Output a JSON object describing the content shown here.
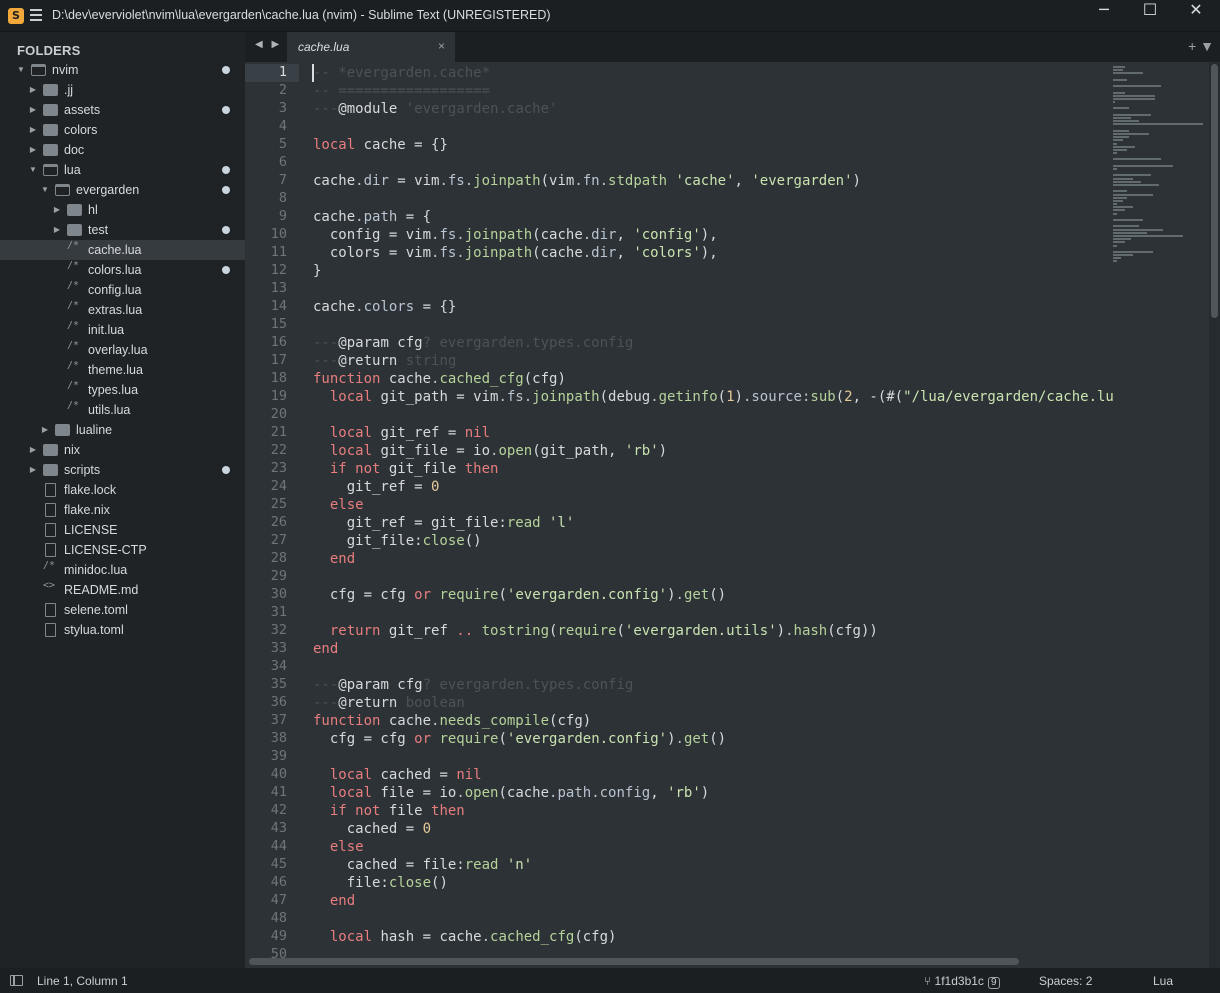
{
  "window": {
    "title": "D:\\dev\\everviolet\\nvim\\lua\\evergarden\\cache.lua (nvim) - Sublime Text (UNREGISTERED)",
    "app_icon": "S",
    "controls": {
      "minimize": "─",
      "maximize": "☐",
      "close": "✕"
    }
  },
  "sidebar": {
    "heading": "FOLDERS",
    "items": [
      {
        "label": "nvim"
      },
      {
        "label": ".jj"
      },
      {
        "label": "assets"
      },
      {
        "label": "colors"
      },
      {
        "label": "doc"
      },
      {
        "label": "lua"
      },
      {
        "label": "evergarden"
      },
      {
        "label": "hl"
      },
      {
        "label": "test"
      },
      {
        "label": "cache.lua"
      },
      {
        "label": "colors.lua"
      },
      {
        "label": "config.lua"
      },
      {
        "label": "extras.lua"
      },
      {
        "label": "init.lua"
      },
      {
        "label": "overlay.lua"
      },
      {
        "label": "theme.lua"
      },
      {
        "label": "types.lua"
      },
      {
        "label": "utils.lua"
      },
      {
        "label": "lualine"
      },
      {
        "label": "nix"
      },
      {
        "label": "scripts"
      },
      {
        "label": "flake.lock"
      },
      {
        "label": "flake.nix"
      },
      {
        "label": "LICENSE"
      },
      {
        "label": "LICENSE-CTP"
      },
      {
        "label": "minidoc.lua"
      },
      {
        "label": "README.md"
      },
      {
        "label": "selene.toml"
      },
      {
        "label": "stylua.toml"
      }
    ]
  },
  "tabs": {
    "nav": "◀ ▶",
    "active": {
      "label": "cache.lua",
      "close": "×"
    },
    "right_controls": "+ ▼"
  },
  "editor": {
    "language": "Lua",
    "line_numbers": [
      "1",
      "2",
      "3",
      "4",
      "5",
      "6",
      "7",
      "8",
      "9",
      "10",
      "11",
      "12",
      "13",
      "14",
      "15",
      "16",
      "17",
      "18",
      "19",
      "20",
      "21",
      "22",
      "23",
      "24",
      "25",
      "26",
      "27",
      "28",
      "29",
      "30",
      "31",
      "32",
      "33",
      "34",
      "35",
      "36",
      "37",
      "38",
      "39",
      "40",
      "41",
      "42",
      "43",
      "44",
      "45",
      "46",
      "47",
      "48",
      "49",
      "50"
    ],
    "current_line": "1"
  },
  "statusbar": {
    "position": "Line 1, Column 1",
    "vcs": "1f1d3b1c",
    "vcs_badge": "9",
    "indent": "Spaces: 2",
    "syntax": "Lua"
  },
  "colors": {
    "editor_bg": "#2c3236",
    "sidebar_bg": "#1f2326",
    "keyword": "#e87d7d",
    "function": "#b5d29a",
    "string": "#c9e3b0",
    "number": "#e6c99a",
    "comment": "#4a5358"
  }
}
